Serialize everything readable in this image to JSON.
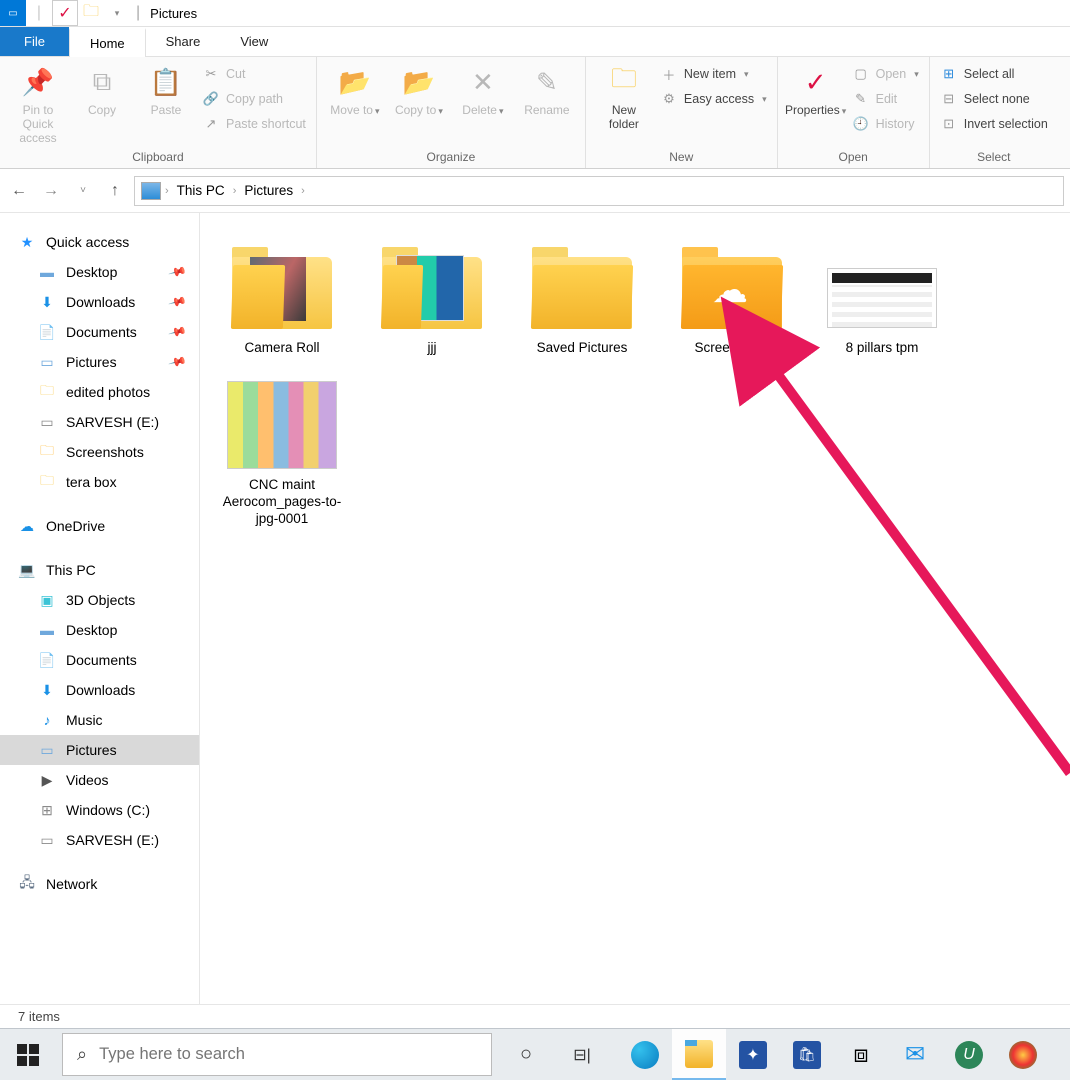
{
  "window_title": "Pictures",
  "tabs": {
    "file": "File",
    "home": "Home",
    "share": "Share",
    "view": "View"
  },
  "ribbon": {
    "clipboard": {
      "label": "Clipboard",
      "pin": "Pin to Quick access",
      "copy": "Copy",
      "paste": "Paste",
      "cut": "Cut",
      "copy_path": "Copy path",
      "paste_shortcut": "Paste shortcut"
    },
    "organize": {
      "label": "Organize",
      "move": "Move to",
      "copy_to": "Copy to",
      "delete": "Delete",
      "rename": "Rename"
    },
    "new": {
      "label": "New",
      "new_folder": "New folder",
      "new_item": "New item",
      "easy_access": "Easy access"
    },
    "open": {
      "label": "Open",
      "properties": "Properties",
      "open": "Open",
      "edit": "Edit",
      "history": "History"
    },
    "select": {
      "label": "Select",
      "all": "Select all",
      "none": "Select none",
      "invert": "Invert selection"
    }
  },
  "breadcrumb": {
    "pc": "This PC",
    "pictures": "Pictures"
  },
  "sidebar": {
    "quick": "Quick access",
    "quick_items": [
      {
        "label": "Desktop"
      },
      {
        "label": "Downloads"
      },
      {
        "label": "Documents"
      },
      {
        "label": "Pictures"
      },
      {
        "label": "edited photos"
      },
      {
        "label": "SARVESH (E:)"
      },
      {
        "label": "Screenshots"
      },
      {
        "label": "tera box"
      }
    ],
    "onedrive": "OneDrive",
    "this_pc": "This PC",
    "pc_items": [
      "3D Objects",
      "Desktop",
      "Documents",
      "Downloads",
      "Music",
      "Pictures",
      "Videos",
      "Windows (C:)",
      "SARVESH (E:)"
    ],
    "network": "Network"
  },
  "items": [
    {
      "name": "Camera Roll",
      "kind": "folder-photo"
    },
    {
      "name": "jjj",
      "kind": "folder-doc"
    },
    {
      "name": "Saved Pictures",
      "kind": "folder"
    },
    {
      "name": "Screenshots",
      "kind": "folder-cloud"
    },
    {
      "name": "8 pillars tpm",
      "kind": "image-table"
    },
    {
      "name": "CNC maint Aerocom_pages-to-jpg-0001",
      "kind": "image-color"
    }
  ],
  "status": "7 items",
  "search_placeholder": "Type here to search"
}
